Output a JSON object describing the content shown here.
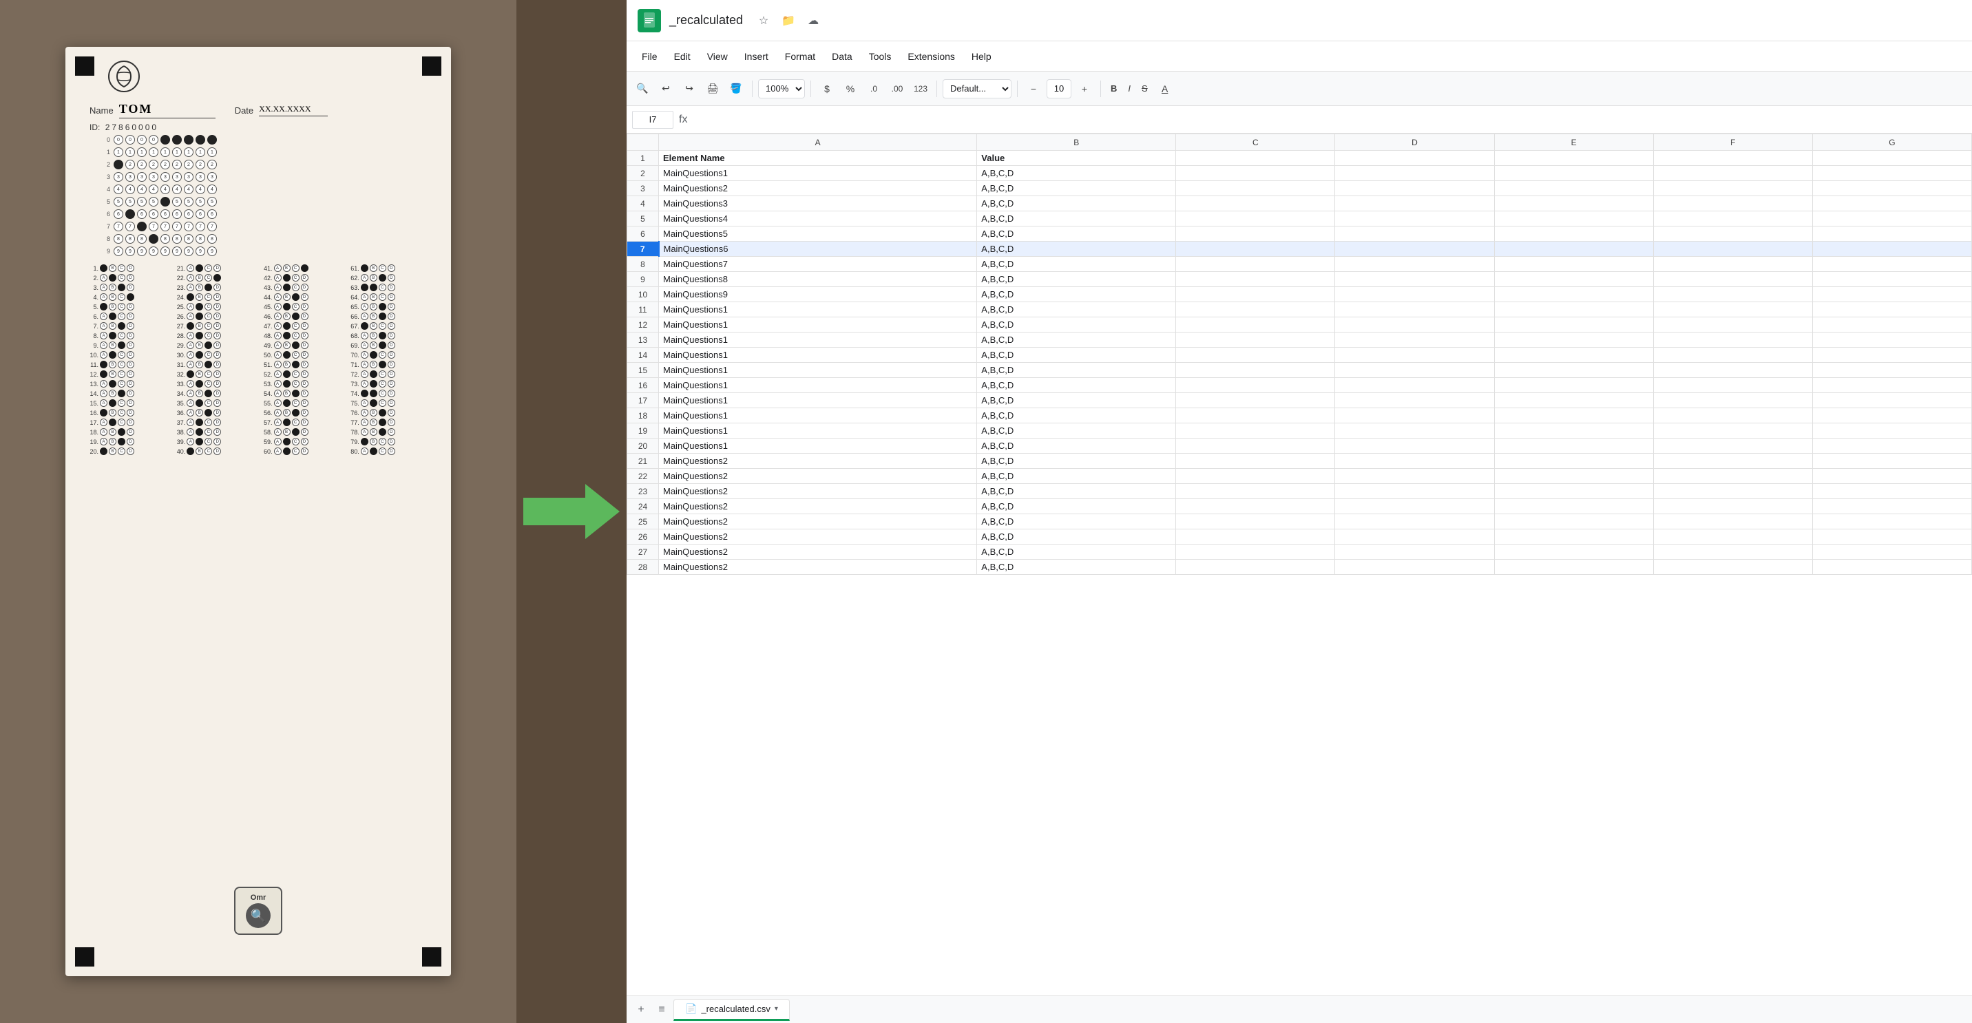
{
  "left_panel": {
    "omr_sheet": {
      "name_label": "Name",
      "name_value": "TOM",
      "date_label": "Date",
      "date_value": "XX.XX.XXXX",
      "id_label": "ID:",
      "id_digits": "27860000",
      "app_label": "Omr"
    }
  },
  "spreadsheet": {
    "file_title": "_recalculated",
    "cell_ref": "I7",
    "formula_value": "",
    "menu_items": [
      "File",
      "Edit",
      "View",
      "Insert",
      "Format",
      "Data",
      "Tools",
      "Extensions",
      "Help"
    ],
    "zoom": "100%",
    "font": "Default...",
    "font_size": "10",
    "column_headers": [
      "",
      "A",
      "B",
      "C",
      "D",
      "E",
      "F",
      "G"
    ],
    "rows": [
      {
        "num": 1,
        "a": "Element Name",
        "b": "Value",
        "c": "",
        "d": "",
        "e": "",
        "f": "",
        "g": ""
      },
      {
        "num": 2,
        "a": "MainQuestions1",
        "b": "A,B,C,D",
        "c": "",
        "d": "",
        "e": "",
        "f": "",
        "g": ""
      },
      {
        "num": 3,
        "a": "MainQuestions2",
        "b": "A,B,C,D",
        "c": "",
        "d": "",
        "e": "",
        "f": "",
        "g": ""
      },
      {
        "num": 4,
        "a": "MainQuestions3",
        "b": "A,B,C,D",
        "c": "",
        "d": "",
        "e": "",
        "f": "",
        "g": ""
      },
      {
        "num": 5,
        "a": "MainQuestions4",
        "b": "A,B,C,D",
        "c": "",
        "d": "",
        "e": "",
        "f": "",
        "g": ""
      },
      {
        "num": 6,
        "a": "MainQuestions5",
        "b": "A,B,C,D",
        "c": "",
        "d": "",
        "e": "",
        "f": "",
        "g": ""
      },
      {
        "num": 7,
        "a": "MainQuestions6",
        "b": "A,B,C,D",
        "c": "",
        "d": "",
        "e": "",
        "f": "",
        "g": "",
        "selected": true
      },
      {
        "num": 8,
        "a": "MainQuestions7",
        "b": "A,B,C,D",
        "c": "",
        "d": "",
        "e": "",
        "f": "",
        "g": ""
      },
      {
        "num": 9,
        "a": "MainQuestions8",
        "b": "A,B,C,D",
        "c": "",
        "d": "",
        "e": "",
        "f": "",
        "g": ""
      },
      {
        "num": 10,
        "a": "MainQuestions9",
        "b": "A,B,C,D",
        "c": "",
        "d": "",
        "e": "",
        "f": "",
        "g": ""
      },
      {
        "num": 11,
        "a": "MainQuestions1",
        "b": "A,B,C,D",
        "c": "",
        "d": "",
        "e": "",
        "f": "",
        "g": ""
      },
      {
        "num": 12,
        "a": "MainQuestions1",
        "b": "A,B,C,D",
        "c": "",
        "d": "",
        "e": "",
        "f": "",
        "g": ""
      },
      {
        "num": 13,
        "a": "MainQuestions1",
        "b": "A,B,C,D",
        "c": "",
        "d": "",
        "e": "",
        "f": "",
        "g": ""
      },
      {
        "num": 14,
        "a": "MainQuestions1",
        "b": "A,B,C,D",
        "c": "",
        "d": "",
        "e": "",
        "f": "",
        "g": ""
      },
      {
        "num": 15,
        "a": "MainQuestions1",
        "b": "A,B,C,D",
        "c": "",
        "d": "",
        "e": "",
        "f": "",
        "g": ""
      },
      {
        "num": 16,
        "a": "MainQuestions1",
        "b": "A,B,C,D",
        "c": "",
        "d": "",
        "e": "",
        "f": "",
        "g": ""
      },
      {
        "num": 17,
        "a": "MainQuestions1",
        "b": "A,B,C,D",
        "c": "",
        "d": "",
        "e": "",
        "f": "",
        "g": ""
      },
      {
        "num": 18,
        "a": "MainQuestions1",
        "b": "A,B,C,D",
        "c": "",
        "d": "",
        "e": "",
        "f": "",
        "g": ""
      },
      {
        "num": 19,
        "a": "MainQuestions1",
        "b": "A,B,C,D",
        "c": "",
        "d": "",
        "e": "",
        "f": "",
        "g": ""
      },
      {
        "num": 20,
        "a": "MainQuestions1",
        "b": "A,B,C,D",
        "c": "",
        "d": "",
        "e": "",
        "f": "",
        "g": ""
      },
      {
        "num": 21,
        "a": "MainQuestions2",
        "b": "A,B,C,D",
        "c": "",
        "d": "",
        "e": "",
        "f": "",
        "g": ""
      },
      {
        "num": 22,
        "a": "MainQuestions2",
        "b": "A,B,C,D",
        "c": "",
        "d": "",
        "e": "",
        "f": "",
        "g": ""
      },
      {
        "num": 23,
        "a": "MainQuestions2",
        "b": "A,B,C,D",
        "c": "",
        "d": "",
        "e": "",
        "f": "",
        "g": ""
      },
      {
        "num": 24,
        "a": "MainQuestions2",
        "b": "A,B,C,D",
        "c": "",
        "d": "",
        "e": "",
        "f": "",
        "g": ""
      },
      {
        "num": 25,
        "a": "MainQuestions2",
        "b": "A,B,C,D",
        "c": "",
        "d": "",
        "e": "",
        "f": "",
        "g": ""
      },
      {
        "num": 26,
        "a": "MainQuestions2",
        "b": "A,B,C,D",
        "c": "",
        "d": "",
        "e": "",
        "f": "",
        "g": ""
      },
      {
        "num": 27,
        "a": "MainQuestions2",
        "b": "A,B,C,D",
        "c": "",
        "d": "",
        "e": "",
        "f": "",
        "g": ""
      },
      {
        "num": 28,
        "a": "MainQuestions2",
        "b": "A,B,C,D",
        "c": "",
        "d": "",
        "e": "",
        "f": "",
        "g": ""
      }
    ],
    "sheet_tab_label": "_recalculated.csv"
  }
}
